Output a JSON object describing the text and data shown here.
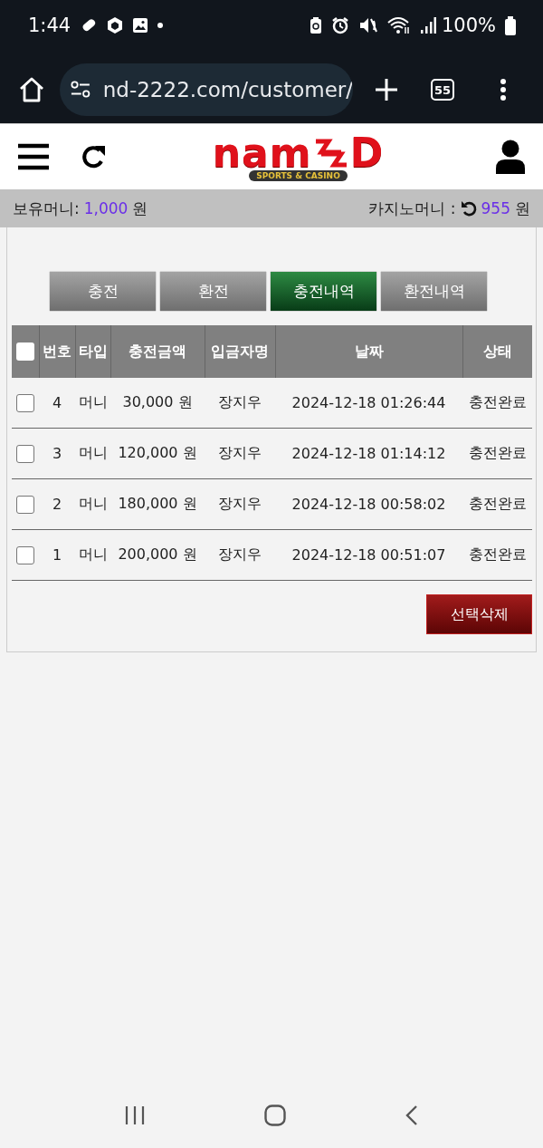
{
  "status_bar": {
    "time": "1:44",
    "battery": "100%"
  },
  "browser": {
    "url": "nd-2222.com/customer/",
    "tab_count": "55"
  },
  "header": {
    "logo_start": "nam",
    "logo_end": "D",
    "tagline": "SPORTS & CASINO"
  },
  "balance": {
    "label": "보유머니:",
    "amount": "1,000",
    "unit": "원",
    "casino_label": "카지노머니 :",
    "casino_amount": "955",
    "casino_unit": "원"
  },
  "tabs": [
    {
      "label": "충전",
      "selected": false
    },
    {
      "label": "환전",
      "selected": false
    },
    {
      "label": "충전내역",
      "selected": true
    },
    {
      "label": "환전내역",
      "selected": false
    }
  ],
  "table": {
    "select_all": false,
    "columns": [
      "번호",
      "타입",
      "충전금액",
      "입금자명",
      "날짜",
      "상태"
    ],
    "rows": [
      {
        "checked": false,
        "cells": [
          "4",
          "머니",
          "30,000 원",
          "장지우",
          "2024-12-18 01:26:44",
          "충전완료"
        ]
      },
      {
        "checked": false,
        "cells": [
          "3",
          "머니",
          "120,000 원",
          "장지우",
          "2024-12-18 01:14:12",
          "충전완료"
        ]
      },
      {
        "checked": false,
        "cells": [
          "2",
          "머니",
          "180,000 원",
          "장지우",
          "2024-12-18 00:58:02",
          "충전완료"
        ]
      },
      {
        "checked": false,
        "cells": [
          "1",
          "머니",
          "200,000 원",
          "장지우",
          "2024-12-18 00:51:07",
          "충전완료"
        ]
      }
    ]
  },
  "delete_button": "선택삭제"
}
